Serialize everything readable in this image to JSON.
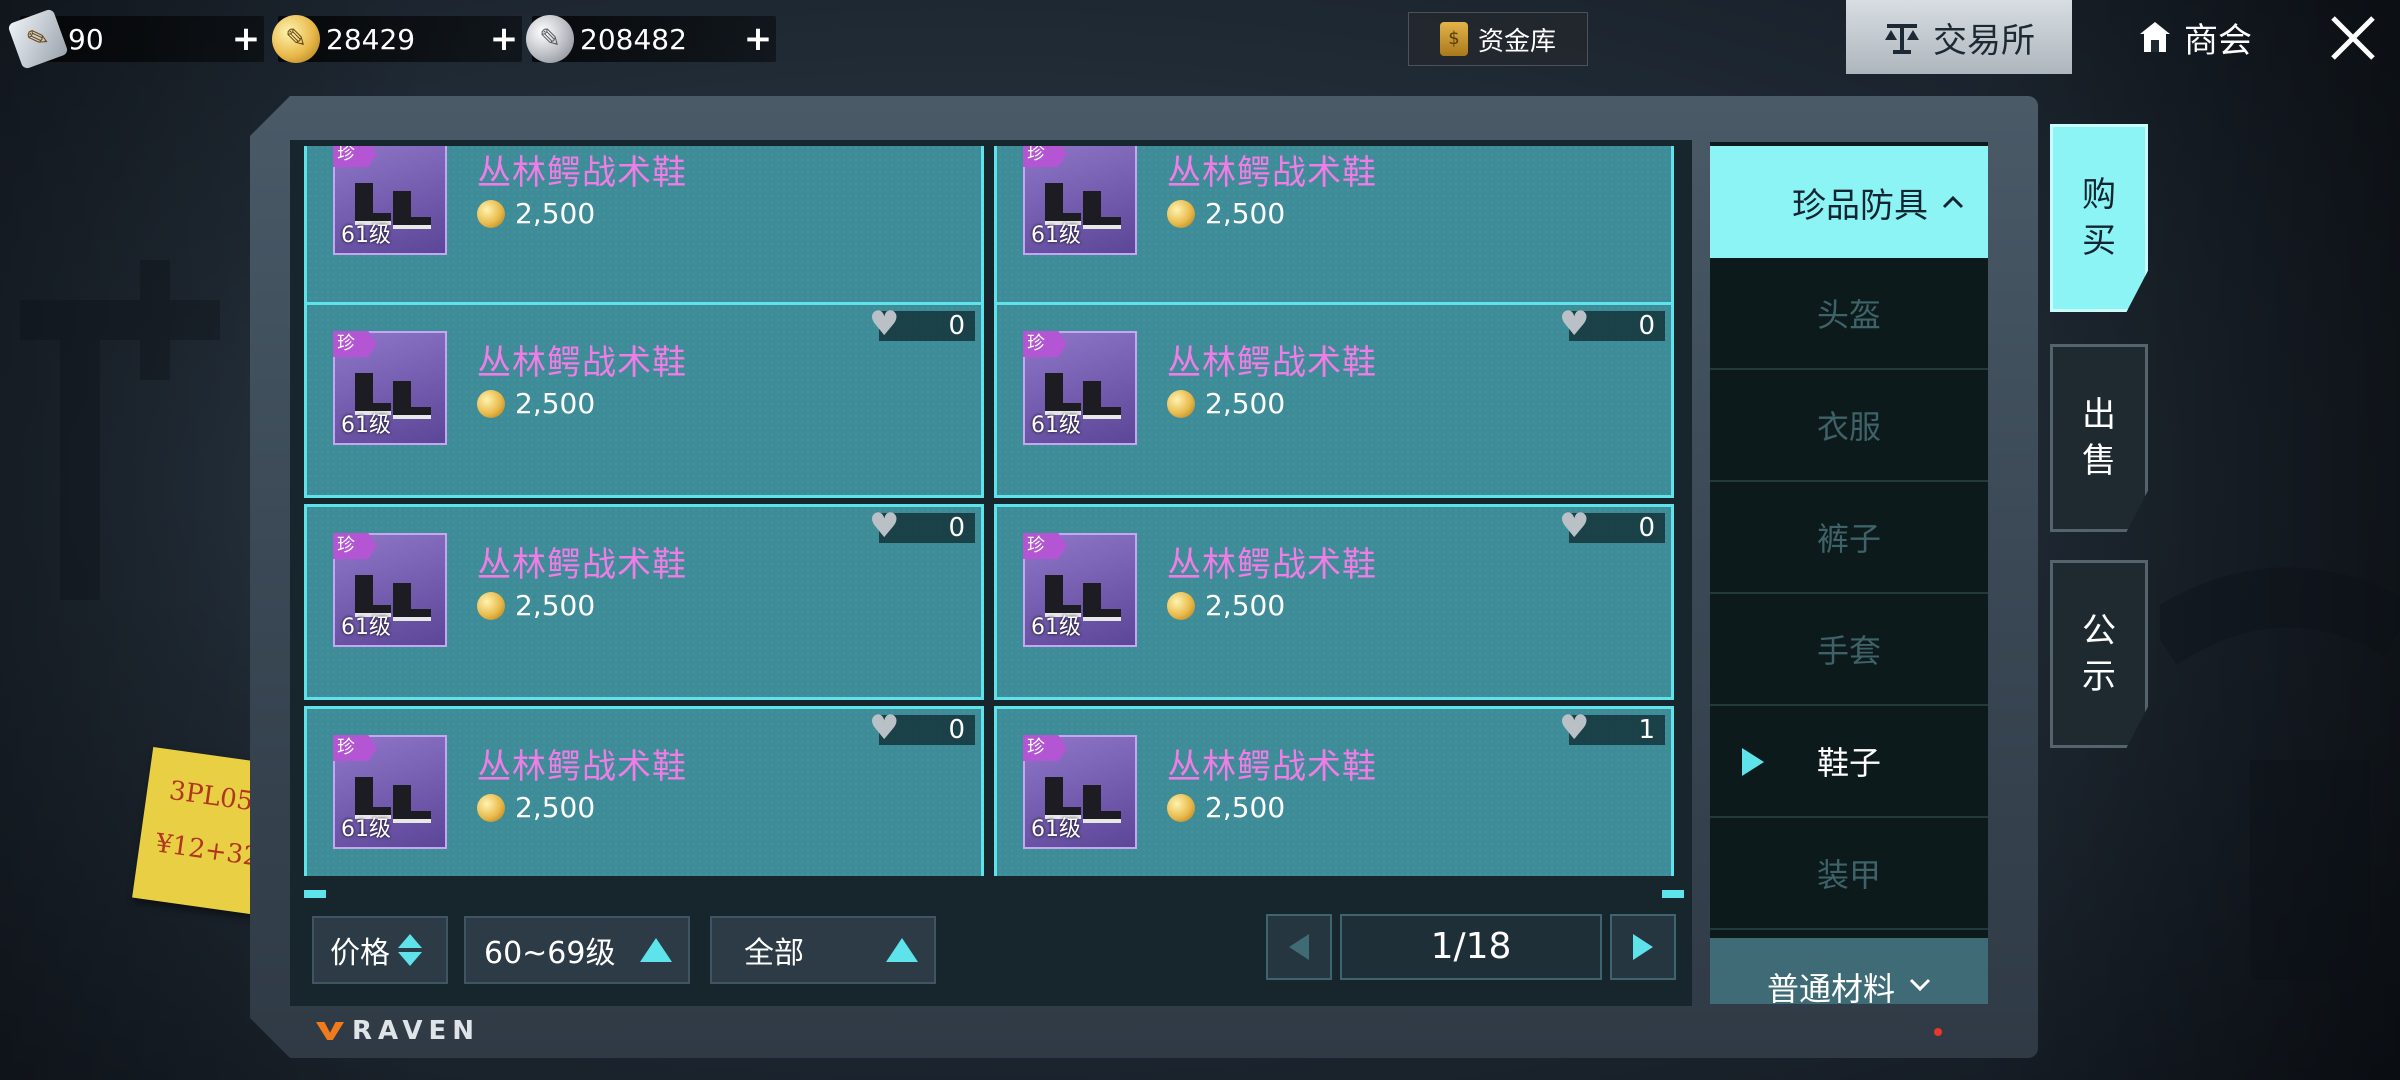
{
  "currencies": [
    {
      "name": "ticket",
      "value": "90",
      "icon": "ticket-icon"
    },
    {
      "name": "gold",
      "value": "28429",
      "icon": "gold-coin-icon"
    },
    {
      "name": "silver",
      "value": "208482",
      "icon": "silver-coin-icon"
    }
  ],
  "header": {
    "vault_label": "资金库",
    "exchange_label": "交易所",
    "guild_label": "商会"
  },
  "items": [
    {
      "name": "丛林鳄战术鞋",
      "price": "2,500",
      "level": "61级",
      "rarity": "珍",
      "likes": ""
    },
    {
      "name": "丛林鳄战术鞋",
      "price": "2,500",
      "level": "61级",
      "rarity": "珍",
      "likes": ""
    },
    {
      "name": "丛林鳄战术鞋",
      "price": "2,500",
      "level": "61级",
      "rarity": "珍",
      "likes": "0"
    },
    {
      "name": "丛林鳄战术鞋",
      "price": "2,500",
      "level": "61级",
      "rarity": "珍",
      "likes": "0"
    },
    {
      "name": "丛林鳄战术鞋",
      "price": "2,500",
      "level": "61级",
      "rarity": "珍",
      "likes": "0"
    },
    {
      "name": "丛林鳄战术鞋",
      "price": "2,500",
      "level": "61级",
      "rarity": "珍",
      "likes": "0"
    },
    {
      "name": "丛林鳄战术鞋",
      "price": "2,500",
      "level": "61级",
      "rarity": "珍",
      "likes": "0"
    },
    {
      "name": "丛林鳄战术鞋",
      "price": "2,500",
      "level": "61级",
      "rarity": "珍",
      "likes": "1"
    }
  ],
  "filters": {
    "sort_label": "价格",
    "level_label": "60~69级",
    "type_label": "全部"
  },
  "pager": {
    "label": "1/18"
  },
  "categories": {
    "header": "珍品防具",
    "items": [
      "头盔",
      "衣服",
      "裤子",
      "手套",
      "鞋子",
      "装甲"
    ],
    "active": "鞋子",
    "footer": "普通材料"
  },
  "side_tabs": {
    "buy": "购\n买",
    "sell": "出\n售",
    "notice": "公\n示"
  },
  "brand": "RAVEN",
  "sticky_note": {
    "line1": "3PL05",
    "line2": "¥12+32"
  },
  "colors": {
    "accent": "#5ee3ea",
    "item_name": "#f07de6",
    "card_bg": "#3d8c98"
  }
}
